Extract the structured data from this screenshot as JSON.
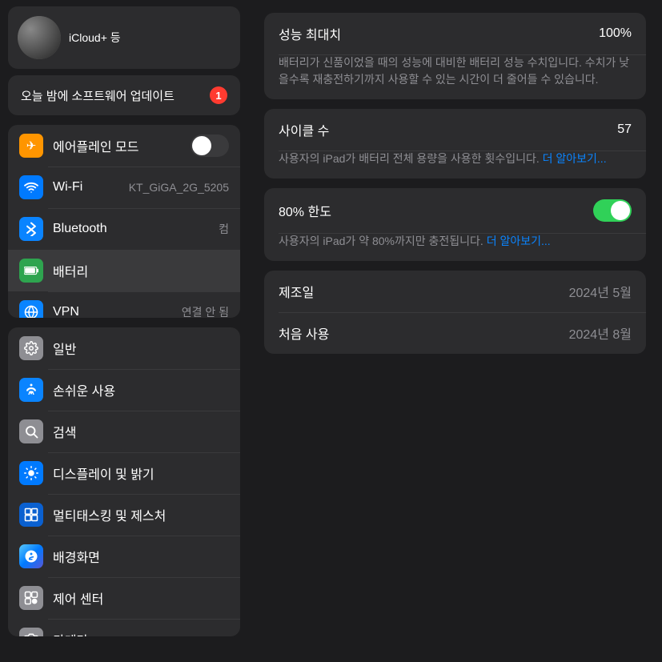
{
  "profile": {
    "subtitle": "iCloud+ 등"
  },
  "update": {
    "label": "오늘 밤에 소프트웨어 업데이트",
    "badge": "1"
  },
  "network_group": {
    "items": [
      {
        "id": "airplane",
        "label": "에어플레인 모드",
        "value": "",
        "type": "toggle",
        "icon_color": "orange",
        "icon": "✈"
      },
      {
        "id": "wifi",
        "label": "Wi-Fi",
        "value": "KT_GiGA_2G_5205",
        "type": "value",
        "icon_color": "blue",
        "icon": "📶"
      },
      {
        "id": "bluetooth",
        "label": "Bluetooth",
        "value": "컴",
        "type": "value",
        "icon_color": "blue-light",
        "icon": "🔵"
      },
      {
        "id": "battery",
        "label": "배터리",
        "value": "",
        "type": "none",
        "icon_color": "battery",
        "icon": "🔋",
        "active": true
      },
      {
        "id": "vpn",
        "label": "VPN",
        "value": "연결 안 됨",
        "type": "value",
        "icon_color": "blue2",
        "icon": "🌐"
      }
    ]
  },
  "settings_group": {
    "items": [
      {
        "id": "general",
        "label": "일반",
        "icon_color": "gray",
        "icon": "⚙"
      },
      {
        "id": "accessibility",
        "label": "손쉬운 사용",
        "icon_color": "blue2",
        "icon": "♿"
      },
      {
        "id": "search",
        "label": "검색",
        "icon_color": "gray",
        "icon": "🔍"
      },
      {
        "id": "display",
        "label": "디스플레이 및 밝기",
        "icon_color": "blue",
        "icon": "☀"
      },
      {
        "id": "multitasking",
        "label": "멀티태스킹 및 제스처",
        "icon_color": "blue",
        "icon": "⬛"
      },
      {
        "id": "wallpaper",
        "label": "배경화면",
        "icon_color": "teal",
        "icon": "❄"
      },
      {
        "id": "control_center",
        "label": "제어 센터",
        "icon_color": "gray",
        "icon": "⬛"
      },
      {
        "id": "camera",
        "label": "카메라",
        "icon_color": "gray",
        "icon": "📷"
      }
    ]
  },
  "battery_panel": {
    "max_performance_label": "성능 최대치",
    "max_performance_value": "100%",
    "max_performance_desc": "배터리가 신품이었을 때의 성능에 대비한 배터리 성능 수치입니다. 수치가 낮을수록 재충전하기까지 사용할 수 있는 시간이 더 줄어들 수 있습니다.",
    "cycle_label": "사이클 수",
    "cycle_value": "57",
    "cycle_desc_prefix": "사용자의 iPad가 배터리 전체 용량을 사용한 횟수입니다.",
    "cycle_desc_link": "더 알아보기...",
    "limit_label": "80% 한도",
    "limit_desc_prefix": "사용자의 iPad가 약 80%까지만 충전됩니다.",
    "limit_desc_link": "더 알아보기...",
    "manufacture_label": "제조일",
    "manufacture_value": "2024년 5월",
    "first_use_label": "처음 사용",
    "first_use_value": "2024년 8월"
  }
}
